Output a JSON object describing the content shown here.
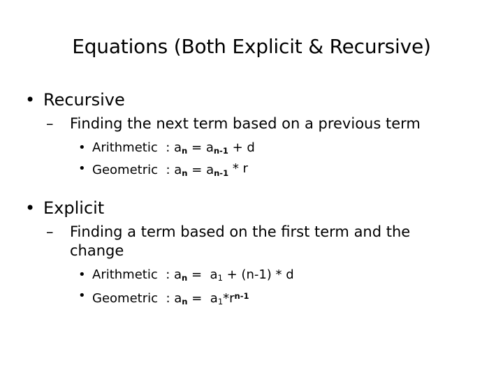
{
  "slide": {
    "title": "Equations (Both Explicit & Recursive)",
    "background_color": "#ffffff",
    "text_color": "#000000",
    "bullet_glyph": "•",
    "dash_glyph": "–",
    "sections": [
      {
        "heading": "Recursive",
        "description": "Finding the next term based on a previous term",
        "items": [
          {
            "label": "Arithmetic",
            "separator": ":",
            "equation_plain": "an = an-1 + d",
            "lhs_base": "a",
            "lhs_sub": "n",
            "equals": "=",
            "rhs_base": "a",
            "rhs_sub": "n-1",
            "rhs_tail": "+ d"
          },
          {
            "label": "Geometric",
            "separator": ":",
            "equation_plain": "an = an-1 * r",
            "lhs_base": "a",
            "lhs_sub": "n",
            "equals": "=",
            "rhs_base": "a",
            "rhs_sub": "n-1",
            "rhs_tail": "* r"
          }
        ]
      },
      {
        "heading": "Explicit",
        "description": "Finding a term based on the first term and the change",
        "items": [
          {
            "label": "Arithmetic",
            "separator": ":",
            "equation_plain": "an =  a1 + (n-1) * d",
            "lhs_base": "a",
            "lhs_sub": "n",
            "equals": "=",
            "rhs_base": "a",
            "rhs_sub": "1",
            "rhs_tail": "+ (n-1) * d"
          },
          {
            "label": "Geometric",
            "separator": ":",
            "equation_plain": "an =  a1*rn-1",
            "lhs_base": "a",
            "lhs_sub": "n",
            "equals": "=",
            "rhs_base": "a",
            "rhs_sub": "1",
            "rhs_mid": "*r",
            "rhs_sup": "n-1"
          }
        ]
      }
    ]
  }
}
